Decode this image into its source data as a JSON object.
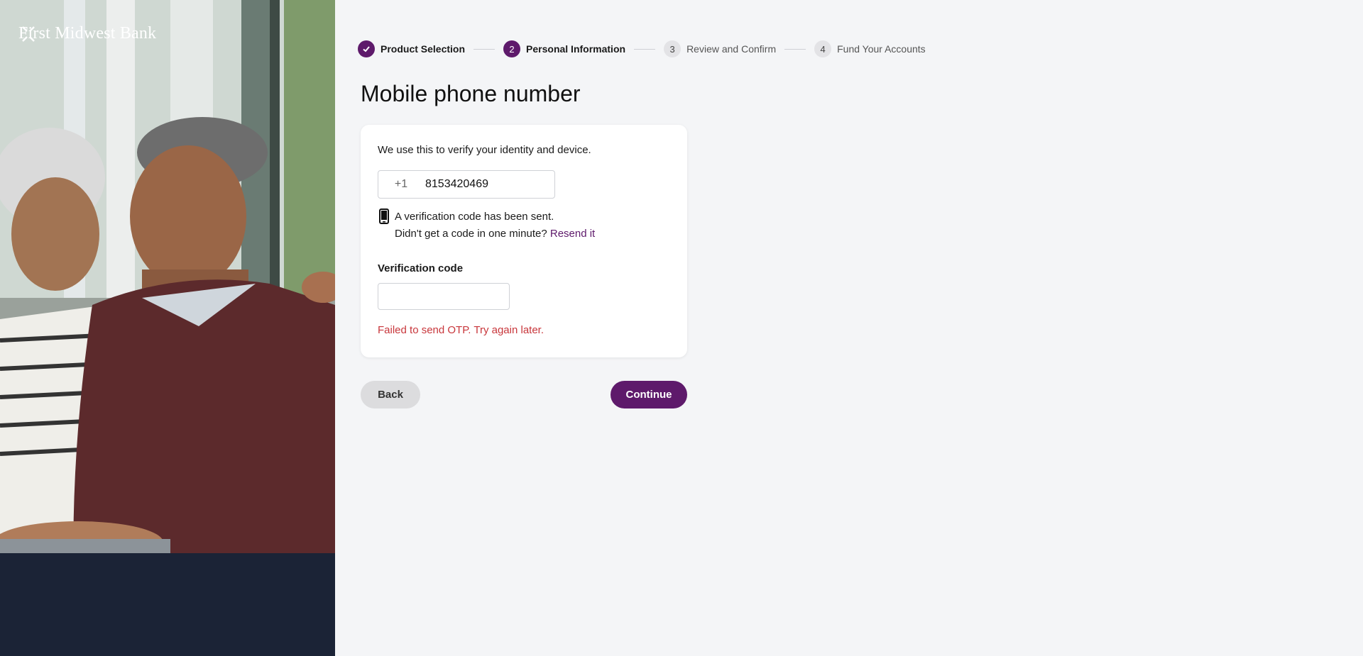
{
  "brand": {
    "name": "First Midwest Bank",
    "accent_color": "#5e1a6b",
    "error_color": "#c8363b"
  },
  "hero_image": {
    "description": "photo-of-senior-couple-using-laptop"
  },
  "stepper": {
    "steps": [
      {
        "number": "",
        "label": "Product Selection",
        "state": "done",
        "icon": "checkmark-icon"
      },
      {
        "number": "2",
        "label": "Personal Information",
        "state": "active"
      },
      {
        "number": "3",
        "label": "Review and Confirm",
        "state": "pending"
      },
      {
        "number": "4",
        "label": "Fund Your Accounts",
        "state": "pending"
      }
    ]
  },
  "page": {
    "title": "Mobile phone number"
  },
  "card": {
    "description": "We use this to verify your identity and device.",
    "phone": {
      "prefix": "+1",
      "value": "8153420469"
    },
    "notice": {
      "icon": "mobile-phone-icon",
      "line1": "A verification code has been sent.",
      "line2": "Didn't get a code in one minute?",
      "resend_label": "Resend it"
    },
    "verification": {
      "label": "Verification code",
      "value": "",
      "placeholder": ""
    },
    "error": "Failed to send OTP. Try again later."
  },
  "actions": {
    "back_label": "Back",
    "continue_label": "Continue"
  }
}
